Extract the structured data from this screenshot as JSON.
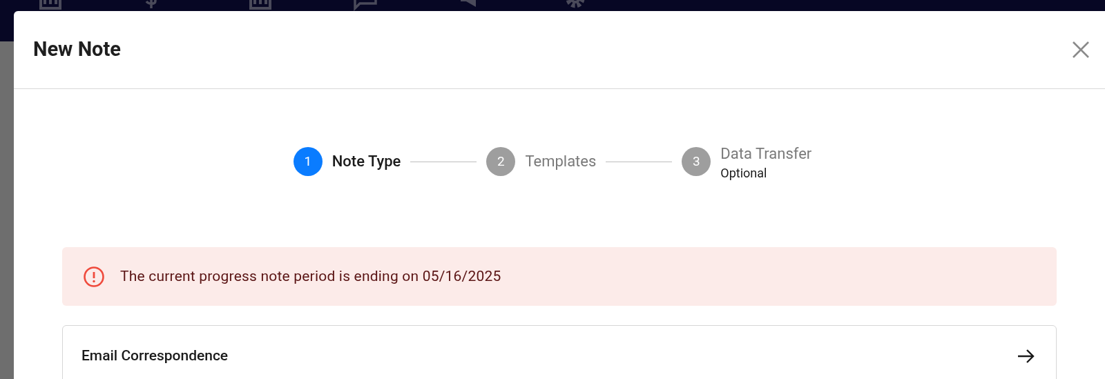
{
  "dialog": {
    "title": "New Note",
    "steps": [
      {
        "number": "1",
        "label": "Note Type",
        "selected": true
      },
      {
        "number": "2",
        "label": "Templates",
        "selected": false
      },
      {
        "number": "3",
        "label": "Data Transfer",
        "sublabel": "Optional",
        "selected": false
      }
    ],
    "alert": {
      "text": "The current progress note period is ending on 05/16/2025"
    },
    "options": [
      {
        "label": "Email Correspondence"
      }
    ]
  }
}
